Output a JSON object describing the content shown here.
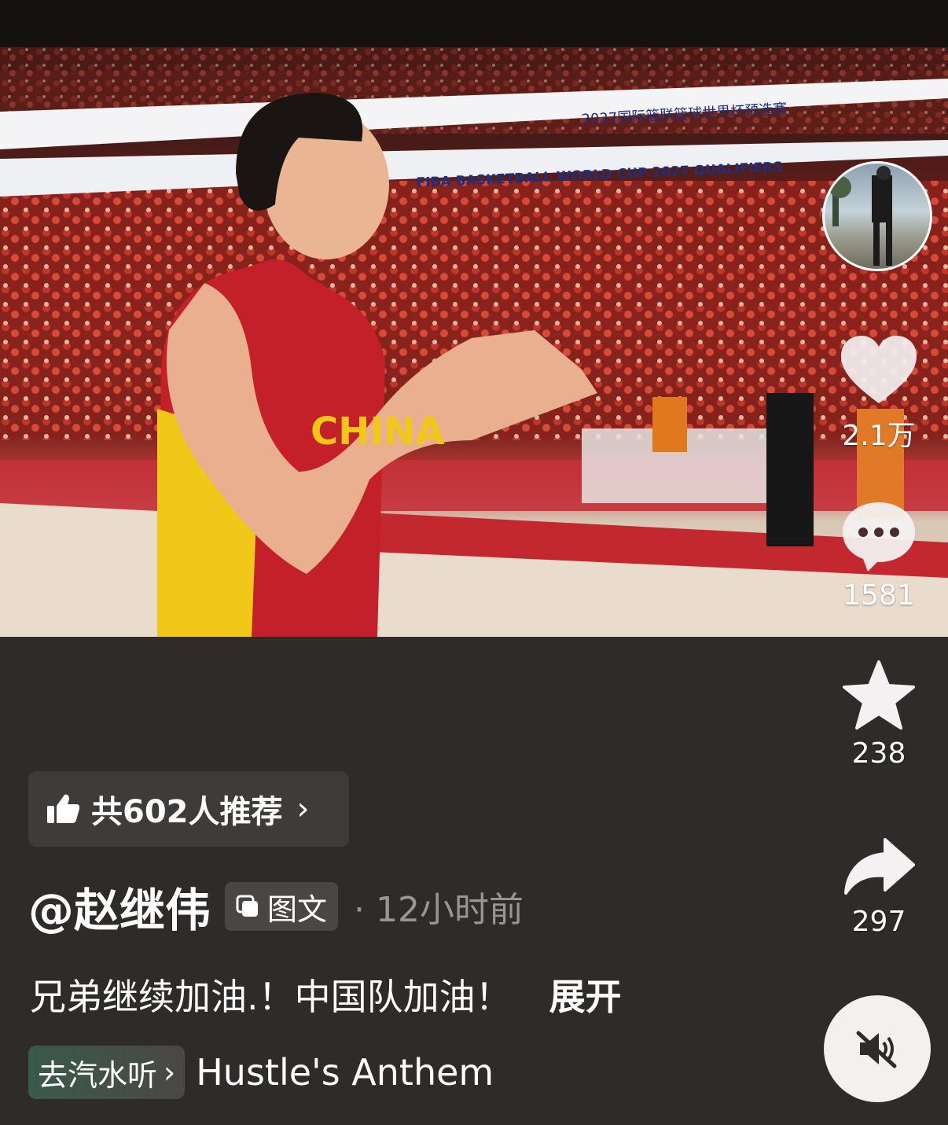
{
  "post": {
    "banner_top": "2027国际篮联篮球世界杯预选赛",
    "banner_bottom": "FIBA BASKETBALL WORLD CUP 2027 QUALIFIERS",
    "jersey_text": "CHINA"
  },
  "actions": {
    "like_count": "2.1万",
    "comment_count": "1581",
    "favorite_count": "238",
    "share_count": "297"
  },
  "recommend": {
    "label": "共602人推荐"
  },
  "author": {
    "name": "@赵继伟",
    "tag": "图文",
    "time": "· 12小时前"
  },
  "caption": {
    "text": "兄弟继续加油.！中国队加油！",
    "expand": "展开"
  },
  "music": {
    "button": "去汽水听",
    "song": "Hustle's Anthem"
  },
  "icons": [
    "heart-icon",
    "comment-icon",
    "star-icon",
    "share-icon",
    "mute-icon",
    "thumbs-up-icon",
    "chevron-right-icon",
    "image-text-icon"
  ]
}
